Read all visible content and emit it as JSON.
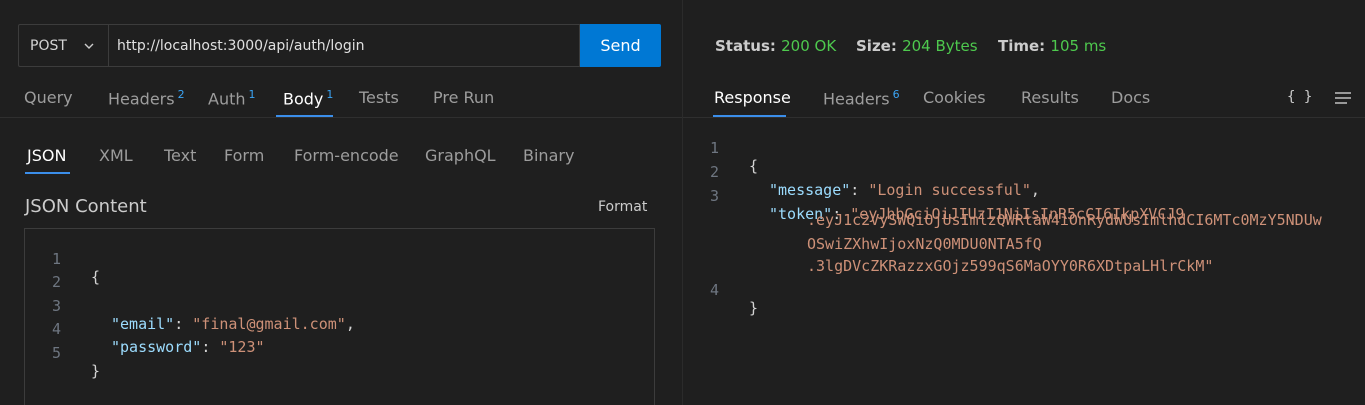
{
  "request": {
    "method": "POST",
    "url": "http://localhost:3000/api/auth/login",
    "send_label": "Send",
    "tabs": [
      {
        "label": "Query",
        "badge": ""
      },
      {
        "label": "Headers",
        "badge": "2"
      },
      {
        "label": "Auth",
        "badge": "1"
      },
      {
        "label": "Body",
        "badge": "1"
      },
      {
        "label": "Tests",
        "badge": ""
      },
      {
        "label": "Pre Run",
        "badge": ""
      }
    ],
    "active_tab": "Body",
    "body_tabs": [
      "JSON",
      "XML",
      "Text",
      "Form",
      "Form-encode",
      "GraphQL",
      "Binary"
    ],
    "active_body_tab": "JSON",
    "content_title": "JSON Content",
    "format_label": "Format",
    "lines": [
      {
        "n": "1",
        "brace": "{"
      },
      {
        "n": "2"
      },
      {
        "n": "3",
        "key": "\"email\"",
        "value": "\"final@gmail.com\"",
        "trail": ","
      },
      {
        "n": "4",
        "key": "\"password\"",
        "value": "\"123\"",
        "trail": ""
      },
      {
        "n": "5",
        "brace": "}"
      }
    ]
  },
  "response": {
    "status_label": "Status:",
    "status_value": "200 OK",
    "size_label": "Size:",
    "size_value": "204 Bytes",
    "time_label": "Time:",
    "time_value": "105 ms",
    "tabs": [
      {
        "label": "Response",
        "badge": ""
      },
      {
        "label": "Headers",
        "badge": "6"
      },
      {
        "label": "Cookies",
        "badge": ""
      },
      {
        "label": "Results",
        "badge": ""
      },
      {
        "label": "Docs",
        "badge": ""
      }
    ],
    "active_tab": "Response",
    "braces_icon": "{ }",
    "lines": [
      {
        "n": "1",
        "text": "{"
      },
      {
        "n": "2",
        "key": "\"message\"",
        "value": "\"Login successful\"",
        "trail": ","
      },
      {
        "n": "3",
        "key": "\"token\"",
        "value": "\"eyJhbGciOiJIUzI1NiIsInR5cCI6IkpXVCJ9"
      },
      {
        "n": "",
        "value": ".eyJ1c2VySWQiOjUsImlzQWRtaW4iOnRydWUsImlhdCI6MTc0MzY5NDUw"
      },
      {
        "n": "",
        "value": "OSwiZXhwIjoxNzQ0MDU0NTA5fQ"
      },
      {
        "n": "",
        "value": ".3lgDVcZKRazzxGOjz599qS6MaOYY0R6XDtpaLHlrCkM\""
      },
      {
        "n": "4",
        "text": "}"
      }
    ]
  },
  "colors": {
    "accent": "#0078d4",
    "status_ok": "#4ec94e",
    "json_key": "#9cdcfe",
    "json_string": "#ce9178"
  }
}
